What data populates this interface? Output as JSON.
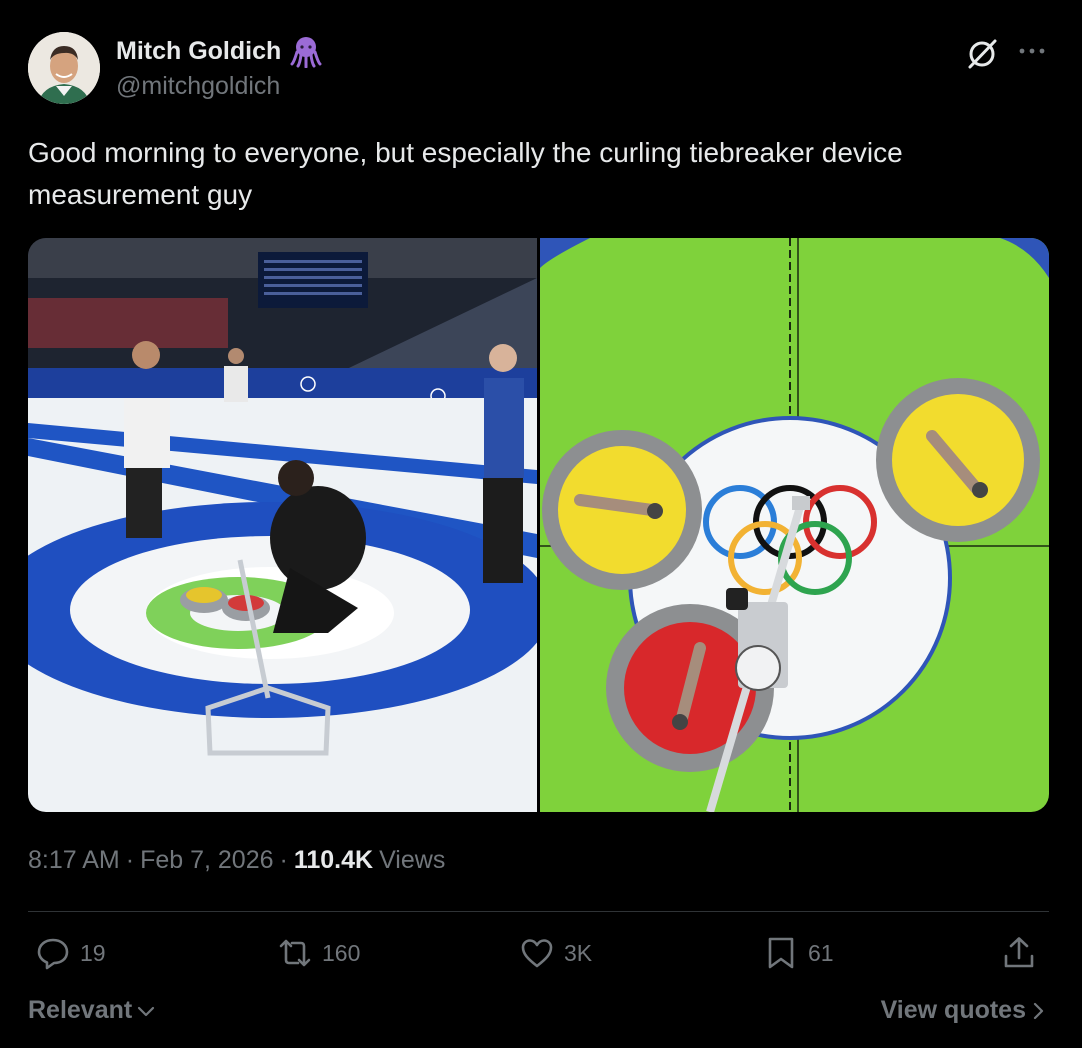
{
  "author": {
    "display_name": "Mitch Goldich",
    "handle": "@mitchgoldich",
    "badge_icon": "octopus-emoji",
    "badge_char": "🐙"
  },
  "tweet": {
    "text": "Good morning to everyone, but especially the curling tiebreaker device measurement guy"
  },
  "meta": {
    "time": "8:17 AM",
    "sep1": "·",
    "date": "Feb 7, 2026",
    "sep2": "·",
    "views_count": "110.4K",
    "views_label": "Views"
  },
  "actions": {
    "replies": "19",
    "retweets": "160",
    "likes": "3K",
    "bookmarks": "61"
  },
  "footer": {
    "sort_label": "Relevant",
    "view_quotes_label": "View quotes"
  },
  "colors": {
    "background": "#000000",
    "text_primary": "#e7e9ea",
    "text_secondary": "#71767b",
    "divider": "#2f3336"
  }
}
